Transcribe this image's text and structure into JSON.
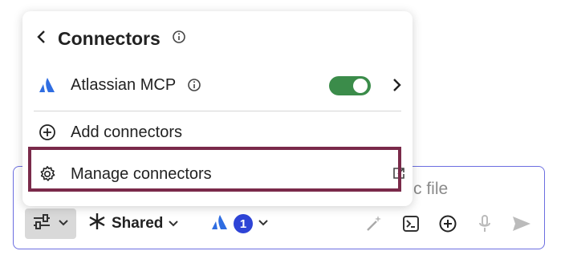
{
  "composer": {
    "placeholder_suffix": "c file",
    "tools_label": "tools",
    "shared_label": "Shared",
    "connector_badge": "1"
  },
  "menu": {
    "title": "Connectors",
    "items": [
      {
        "label": "Atlassian MCP",
        "enabled": true
      },
      {
        "label": "Add connectors"
      },
      {
        "label": "Manage connectors"
      }
    ]
  },
  "colors": {
    "accent_border": "#6b6ee0",
    "toggle_on": "#3b8c4a",
    "badge": "#2e44d6",
    "highlight": "#7a2a4a",
    "atlassian_blue": "#2f6de1"
  }
}
